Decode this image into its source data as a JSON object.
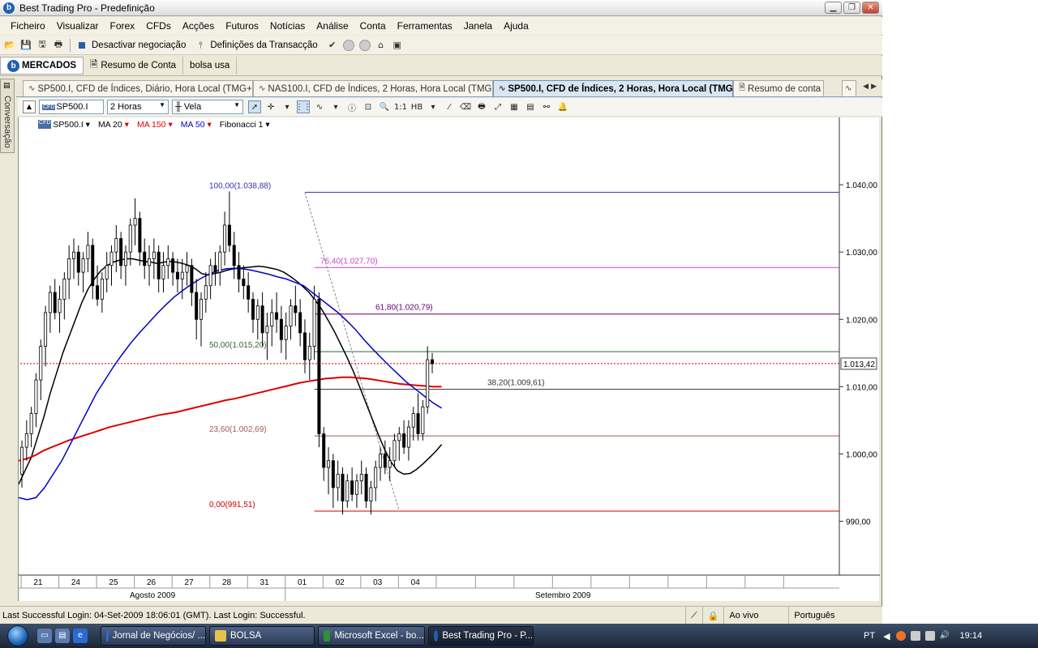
{
  "window": {
    "title": "Best Trading Pro - Predefinição"
  },
  "menu": [
    "Ficheiro",
    "Visualizar",
    "Forex",
    "CFDs",
    "Acções",
    "Futuros",
    "Notícias",
    "Análise",
    "Conta",
    "Ferramentas",
    "Janela",
    "Ajuda"
  ],
  "toolbar": {
    "deactivate_label": "Desactivar negociação",
    "settings_label": "Definições da Transacção"
  },
  "mainbar": {
    "markets": "MERCADOS",
    "account_summary": "Resumo de Conta",
    "bolsa": "bolsa usa"
  },
  "side_label": "Conversação",
  "tabs": [
    {
      "label": "SP500.I, CFD de Índices, Diário, Hora Local (TMG+0)"
    },
    {
      "label": "NAS100.I, CFD de Índices, 2 Horas, Hora Local (TMG+0)"
    },
    {
      "label": "SP500.I, CFD de Índices, 2 Horas, Hora Local (TMG+0)"
    },
    {
      "label": "Resumo de conta"
    }
  ],
  "chart_toolbar": {
    "symbol": "SP500.I",
    "period": "2 Horas",
    "chart_style": "Vela"
  },
  "legend": [
    {
      "label": "SP500.I",
      "color": "#000000"
    },
    {
      "label": "MA 20",
      "color": "#000000"
    },
    {
      "label": "MA 150",
      "color": "#dd0000"
    },
    {
      "label": "MA 50",
      "color": "#0000cc"
    },
    {
      "label": "Fibonacci 1",
      "color": "#000000"
    }
  ],
  "chart_data": {
    "type": "candlestick",
    "symbol": "SP500.I",
    "period": "2 Horas",
    "ylim": [
      982,
      1050
    ],
    "yticks": [
      {
        "value": 990,
        "label": "990,00"
      },
      {
        "value": 1000,
        "label": "1.000,00"
      },
      {
        "value": 1010,
        "label": "1.010,00"
      },
      {
        "value": 1020,
        "label": "1.020,00"
      },
      {
        "value": 1030,
        "label": "1.030,00"
      },
      {
        "value": 1040,
        "label": "1.040,00"
      }
    ],
    "current_price": {
      "value": 1013.42,
      "label": "1.013,42"
    },
    "x_day_labels": [
      "21",
      "24",
      "25",
      "26",
      "27",
      "28",
      "31",
      "01",
      "02",
      "03",
      "04"
    ],
    "x_month_labels": [
      "Agosto 2009",
      "Setembro 2009"
    ],
    "fibonacci_levels": [
      {
        "label": "100,00(1.038,88)",
        "value": 1038.88,
        "color": "#3333aa"
      },
      {
        "label": "76,40(1.027,70)",
        "value": 1027.7,
        "color": "#cc44cc"
      },
      {
        "label": "61,80(1.020,79)",
        "value": 1020.79,
        "color": "#660066"
      },
      {
        "label": "50,00(1.015,20)",
        "value": 1015.2,
        "color": "#336633"
      },
      {
        "label": "38,20(1.009,61)",
        "value": 1009.61,
        "color": "#333333"
      },
      {
        "label": "23,60(1.002,69)",
        "value": 1002.69,
        "color": "#aa5555"
      },
      {
        "label": "0,00(991,51)",
        "value": 991.51,
        "color": "#cc0000"
      }
    ],
    "candles": [
      [
        997,
        1002,
        995,
        1001
      ],
      [
        1001,
        1005,
        999,
        1003
      ],
      [
        1003,
        1007,
        1001,
        1006
      ],
      [
        1006,
        1012,
        1004,
        1011
      ],
      [
        1011,
        1017,
        1008,
        1016
      ],
      [
        1016,
        1022,
        1013,
        1021
      ],
      [
        1021,
        1025,
        1018,
        1024
      ],
      [
        1024,
        1026,
        1020,
        1021
      ],
      [
        1021,
        1025,
        1018,
        1023
      ],
      [
        1023,
        1027,
        1020,
        1026
      ],
      [
        1026,
        1031,
        1023,
        1029
      ],
      [
        1029,
        1032,
        1026,
        1030
      ],
      [
        1030,
        1031,
        1025,
        1027
      ],
      [
        1027,
        1030,
        1024,
        1029
      ],
      [
        1029,
        1033,
        1027,
        1031
      ],
      [
        1031,
        1032,
        1023,
        1025
      ],
      [
        1025,
        1028,
        1022,
        1023
      ],
      [
        1023,
        1027,
        1021,
        1026
      ],
      [
        1026,
        1030,
        1024,
        1028
      ],
      [
        1028,
        1031,
        1025,
        1030
      ],
      [
        1030,
        1034,
        1027,
        1032
      ],
      [
        1032,
        1033,
        1026,
        1028
      ],
      [
        1028,
        1031,
        1025,
        1030
      ],
      [
        1030,
        1035,
        1028,
        1034
      ],
      [
        1034,
        1038,
        1031,
        1035
      ],
      [
        1035,
        1036,
        1028,
        1030
      ],
      [
        1030,
        1032,
        1026,
        1028
      ],
      [
        1028,
        1031,
        1025,
        1029
      ],
      [
        1029,
        1032,
        1026,
        1030
      ],
      [
        1030,
        1031,
        1024,
        1026
      ],
      [
        1026,
        1030,
        1024,
        1028
      ],
      [
        1028,
        1031,
        1026,
        1029
      ],
      [
        1029,
        1030,
        1025,
        1027
      ],
      [
        1027,
        1029,
        1024,
        1026
      ],
      [
        1026,
        1029,
        1023,
        1027
      ],
      [
        1027,
        1030,
        1025,
        1028
      ],
      [
        1028,
        1029,
        1022,
        1024
      ],
      [
        1024,
        1026,
        1017,
        1020
      ],
      [
        1020,
        1024,
        1016,
        1023
      ],
      [
        1023,
        1027,
        1021,
        1025
      ],
      [
        1025,
        1029,
        1023,
        1028
      ],
      [
        1028,
        1030,
        1025,
        1027
      ],
      [
        1027,
        1031,
        1025,
        1030
      ],
      [
        1030,
        1036,
        1028,
        1034
      ],
      [
        1034,
        1039,
        1030,
        1031
      ],
      [
        1031,
        1033,
        1026,
        1028
      ],
      [
        1028,
        1030,
        1024,
        1026
      ],
      [
        1026,
        1028,
        1023,
        1025
      ],
      [
        1025,
        1027,
        1021,
        1023
      ],
      [
        1023,
        1024,
        1018,
        1020
      ],
      [
        1020,
        1023,
        1017,
        1022
      ],
      [
        1022,
        1024,
        1016,
        1018
      ],
      [
        1018,
        1021,
        1014,
        1019
      ],
      [
        1019,
        1023,
        1016,
        1021
      ],
      [
        1021,
        1024,
        1018,
        1020
      ],
      [
        1020,
        1022,
        1015,
        1017
      ],
      [
        1017,
        1021,
        1014,
        1019
      ],
      [
        1019,
        1023,
        1017,
        1022
      ],
      [
        1022,
        1025,
        1019,
        1021
      ],
      [
        1021,
        1023,
        1016,
        1018
      ],
      [
        1018,
        1020,
        1012,
        1014
      ],
      [
        1014,
        1018,
        1011,
        1016
      ],
      [
        1016,
        1025,
        1014,
        1023
      ],
      [
        1023,
        1024,
        1001,
        1003
      ],
      [
        1003,
        1004,
        996,
        998
      ],
      [
        998,
        1001,
        994,
        999
      ],
      [
        999,
        1000,
        992,
        995
      ],
      [
        995,
        999,
        993,
        997
      ],
      [
        997,
        998,
        991,
        993
      ],
      [
        993,
        997,
        992,
        996
      ],
      [
        996,
        998,
        993,
        994
      ],
      [
        994,
        997,
        992,
        996
      ],
      [
        996,
        999,
        994,
        997
      ],
      [
        997,
        998,
        992,
        993
      ],
      [
        993,
        996,
        991,
        995
      ],
      [
        995,
        999,
        993,
        998
      ],
      [
        998,
        1001,
        996,
        1000
      ],
      [
        1000,
        1002,
        997,
        998
      ],
      [
        998,
        1001,
        996,
        999
      ],
      [
        999,
        1003,
        998,
        1002
      ],
      [
        1002,
        1004,
        999,
        1003
      ],
      [
        1003,
        1005,
        1000,
        1001
      ],
      [
        1001,
        1005,
        999,
        1004
      ],
      [
        1004,
        1007,
        1002,
        1006
      ],
      [
        1006,
        1009,
        1002,
        1003
      ],
      [
        1003,
        1008,
        1002,
        1007
      ],
      [
        1007,
        1016,
        1006,
        1014
      ],
      [
        1014,
        1015,
        1012,
        1013.42
      ]
    ],
    "series": [
      {
        "name": "MA 20",
        "color": "#000000",
        "values": [
          995.5,
          997.5,
          999.5,
          1002.5,
          1005.5,
          1009,
          1012,
          1015,
          1017.5,
          1020,
          1022.5,
          1024.5,
          1026,
          1027.2,
          1028,
          1028.5,
          1028.8,
          1029,
          1029,
          1028.8,
          1028.6,
          1028.5,
          1028.3,
          1028.5,
          1028.6,
          1028.5,
          1028.3,
          1028,
          1027.5,
          1026.8,
          1026.6,
          1026.8,
          1027,
          1027.3,
          1027.5,
          1027.6,
          1027.7,
          1027.8,
          1027.9,
          1027.8,
          1027.6,
          1027.4,
          1027,
          1026.4,
          1025.7,
          1024.9,
          1024,
          1022.8,
          1021.5,
          1019.9,
          1018.2,
          1016.3,
          1014.4,
          1012.3,
          1010,
          1007.6,
          1005.2,
          1002.8,
          1000.6,
          998.8,
          997.5,
          997,
          997.1,
          997.7,
          998.5,
          999.4,
          1000.3,
          1001.4
        ]
      },
      {
        "name": "MA 150",
        "color": "#dd0000",
        "values": [
          999,
          999.3,
          999.8,
          1000.5,
          1001,
          1001.5,
          1002,
          1002.4,
          1002.8,
          1003.2,
          1003.6,
          1004,
          1004.3,
          1004.6,
          1004.9,
          1005.2,
          1005.5,
          1005.8,
          1006,
          1006.2,
          1006.5,
          1006.8,
          1007.1,
          1007.4,
          1007.7,
          1008,
          1008.2,
          1008.5,
          1008.8,
          1009.1,
          1009.4,
          1009.7,
          1010,
          1010.3,
          1010.6,
          1010.8,
          1011,
          1011.2,
          1011.3,
          1011.4,
          1011.4,
          1011.3,
          1011.2,
          1011,
          1010.8,
          1010.6,
          1010.4,
          1010.3,
          1010.2,
          1010.1,
          1010,
          1010
        ]
      },
      {
        "name": "MA 50",
        "color": "#0000cc",
        "values": [
          993.5,
          993.2,
          993.5,
          995,
          997,
          999,
          1001.5,
          1004,
          1006.5,
          1009,
          1011,
          1013,
          1014.8,
          1016.5,
          1018,
          1019.4,
          1020.8,
          1022.1,
          1023.3,
          1024.3,
          1025.2,
          1026,
          1026.7,
          1027.2,
          1027.5,
          1027.6,
          1027.5,
          1027.3,
          1027,
          1026.7,
          1026.3,
          1026,
          1025.5,
          1025,
          1024,
          1023,
          1022,
          1021,
          1019.8,
          1018.5,
          1017,
          1015.6,
          1014.3,
          1013,
          1011.8,
          1010.6,
          1009.6,
          1008.6,
          1007.6,
          1006.8
        ]
      }
    ]
  },
  "status": {
    "login": "Last Successful Login: 04-Set-2009 18:06:01 (GMT). Last Login: Successful.",
    "live": "Ao vivo",
    "language": "Português"
  },
  "taskbar": {
    "items": [
      {
        "label": "Jornal de Negócios/ ...",
        "color": "#2b6ad1"
      },
      {
        "label": "BOLSA",
        "color": "#e6c24a"
      },
      {
        "label": "Microsoft Excel - bo...",
        "color": "#2f8f3a"
      },
      {
        "label": "Best Trading Pro - P...",
        "color": "#1f5fb0"
      }
    ],
    "lang": "PT",
    "time": "19:14"
  }
}
